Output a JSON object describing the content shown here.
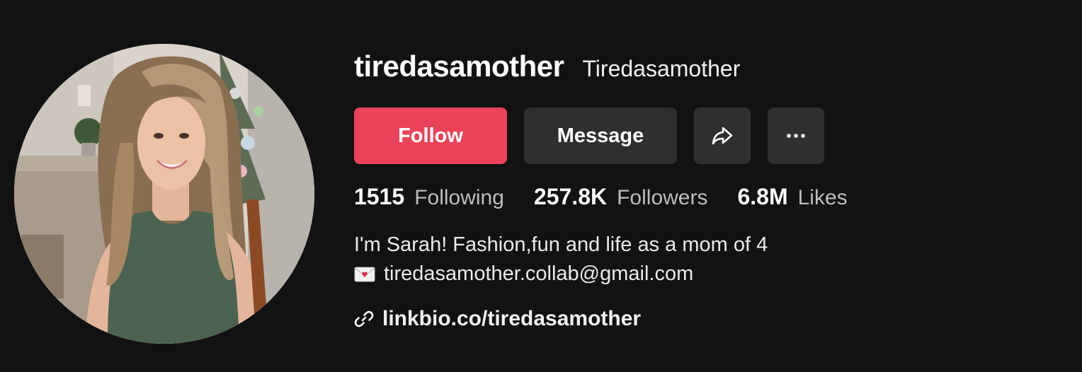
{
  "profile": {
    "username": "tiredasamother",
    "nickname": "Tiredasamother",
    "avatar_icon": "profile-photo"
  },
  "actions": {
    "follow_label": "Follow",
    "message_label": "Message",
    "share_icon": "share-arrow-icon",
    "more_icon": "more-dots-icon"
  },
  "stats": [
    {
      "value": "1515",
      "label": "Following"
    },
    {
      "value": "257.8K",
      "label": "Followers"
    },
    {
      "value": "6.8M",
      "label": "Likes"
    }
  ],
  "bio": {
    "line1": "I'm Sarah! Fashion,fun and life as a mom of 4",
    "email_icon": "love-letter-icon",
    "line2": "tiredasamother.collab@gmail.com"
  },
  "link": {
    "icon": "link-icon",
    "text": "linkbio.co/tiredasamother"
  },
  "colors": {
    "background": "#121212",
    "follow_button": "#ea4359",
    "secondary_button": "#2f2f2f"
  }
}
